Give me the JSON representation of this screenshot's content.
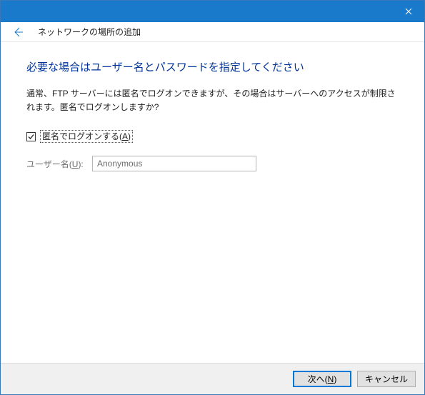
{
  "header": {
    "title": "ネットワークの場所の追加"
  },
  "page": {
    "title": "必要な場合はユーザー名とパスワードを指定してください",
    "description": "通常、FTP サーバーには匿名でログオンできますが、その場合はサーバーへのアクセスが制限されます。匿名でログオンしますか?"
  },
  "anonymous": {
    "checked": true,
    "label_pre": "匿名でログオンする(",
    "label_key": "A",
    "label_post": ")"
  },
  "username": {
    "label_pre": "ユーザー名(",
    "label_key": "U",
    "label_post": "):",
    "value": "Anonymous"
  },
  "buttons": {
    "next_pre": "次へ(",
    "next_key": "N",
    "next_post": ")",
    "cancel": "キャンセル"
  }
}
